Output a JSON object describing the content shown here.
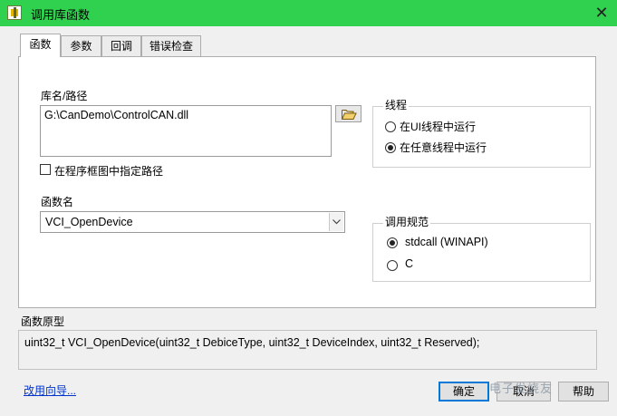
{
  "window": {
    "title": "调用库函数",
    "close_glyph": "✕",
    "title_bar_color": "#2fd14f"
  },
  "tabs": [
    {
      "label": "函数",
      "active": true
    },
    {
      "label": "参数",
      "active": false
    },
    {
      "label": "回调",
      "active": false
    },
    {
      "label": "错误检查",
      "active": false
    }
  ],
  "library": {
    "label": "库名/路径",
    "path_value": "G:\\CanDemo\\ControlCAN.dll",
    "browse_icon": "folder-open-icon",
    "specify_on_diagram_label": "在程序框图中指定路径",
    "specify_on_diagram_checked": false
  },
  "function": {
    "label": "函数名",
    "value": "VCI_OpenDevice"
  },
  "thread": {
    "title": "线程",
    "options": [
      {
        "label": "在UI线程中运行",
        "selected": false
      },
      {
        "label": "在任意线程中运行",
        "selected": true
      }
    ]
  },
  "calling_convention": {
    "title": "调用规范",
    "options": [
      {
        "label": "stdcall (WINAPI)",
        "selected": true
      },
      {
        "label": "C",
        "selected": false
      }
    ]
  },
  "prototype": {
    "label": "函数原型",
    "text": "uint32_t VCI_OpenDevice(uint32_t DebiceType, uint32_t DeviceIndex, uint32_t Reserved);"
  },
  "footer": {
    "wizard_link": "改用向导...",
    "ok_label": "确定",
    "cancel_label": "取消",
    "help_label": "帮助",
    "watermark": "电子发烧友"
  }
}
